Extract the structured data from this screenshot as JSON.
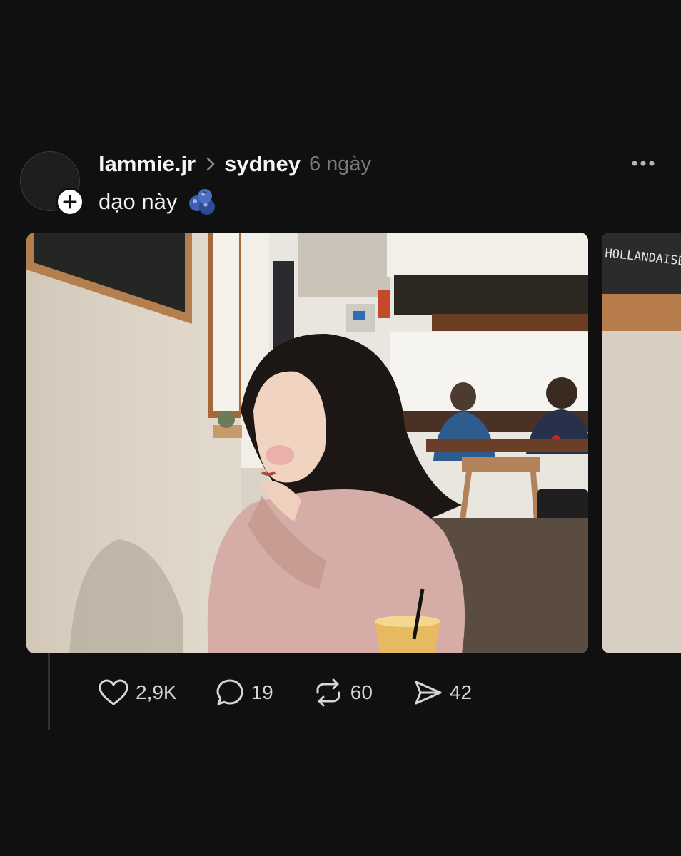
{
  "post": {
    "username": "lammie.jr",
    "community": "sydney",
    "time": "6 ngày",
    "caption": "dạo này",
    "caption_emoji": "blueberries-icon"
  },
  "photos": [
    {
      "alt_icon": "photo-cafe-girl"
    },
    {
      "alt_icon": "photo-cafe-chalkboard",
      "chalkboard_text": "HOLLANDAISE"
    }
  ],
  "actions": {
    "likes": "2,9K",
    "comments": "19",
    "reposts": "60",
    "shares": "42"
  },
  "colors": {
    "background": "#101010",
    "text": "#f3f3f3",
    "muted": "#7a7a7a",
    "action_text": "#d6d6d6"
  }
}
